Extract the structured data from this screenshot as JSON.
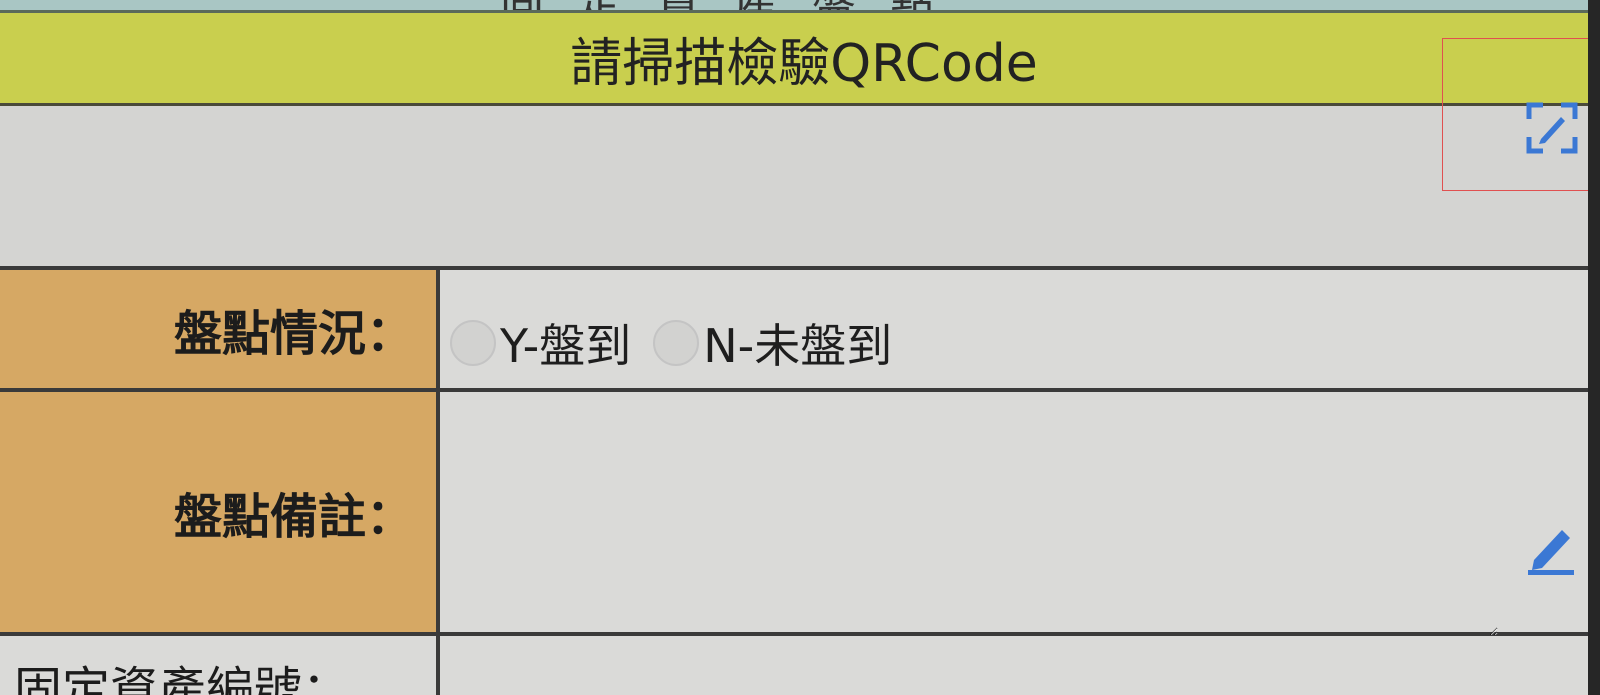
{
  "header": {
    "title": "固定資產盤點",
    "scan_prompt": "請掃描檢驗QRCode"
  },
  "qr": {
    "value": "",
    "scan_icon": "scan-qr-icon"
  },
  "form": {
    "status_label": "盤點情況：",
    "status_options": [
      {
        "label": "Y-盤到",
        "selected": false
      },
      {
        "label": "N-未盤到",
        "selected": false
      }
    ],
    "remark_label": "盤點備註：",
    "remark_value": "",
    "remark_icon": "edit-pencil-icon",
    "next_label": "固定資產編號："
  },
  "colors": {
    "banner": "#c9cf4e",
    "label_bg": "#d6a864",
    "title_bar": "#a9c6c4",
    "accent_icon": "#3b78d4"
  }
}
